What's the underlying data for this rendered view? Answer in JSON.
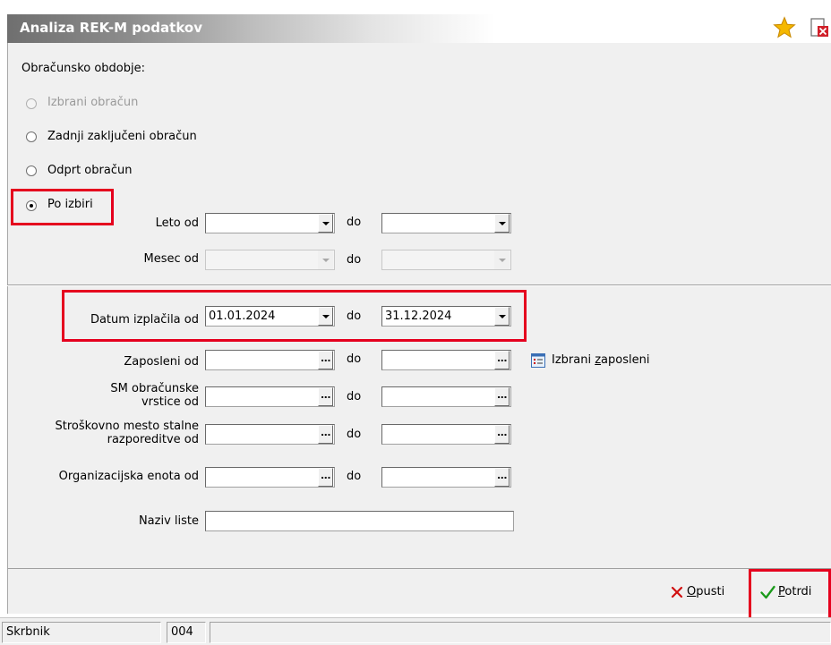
{
  "window": {
    "title": "Analiza REK-M podatkov",
    "icons": [
      "star-icon",
      "page-icon"
    ]
  },
  "period": {
    "label": "Obračunsko obdobje:",
    "options": [
      {
        "label": "Izbrani obračun",
        "state": "disabled"
      },
      {
        "label": "Zadnji zaključeni obračun",
        "state": "unchecked"
      },
      {
        "label": "Odprt obračun",
        "state": "unchecked"
      },
      {
        "label": "Po izbiri",
        "state": "checked"
      }
    ]
  },
  "fields": {
    "to": "do",
    "year_from": {
      "label": "Leto od",
      "value": "",
      "to_value": ""
    },
    "month_from": {
      "label": "Mesec od",
      "value": "",
      "to_value": ""
    },
    "pay_date_from": {
      "label": "Datum izplačila od",
      "value": "01.01.2024",
      "to_value": "31.12.2024"
    },
    "employee_from": {
      "label": "Zaposleni od",
      "value": "",
      "to_value": ""
    },
    "sm_lines_from": {
      "label_line1": "SM obračunske",
      "label_line2": "vrstice od",
      "value": "",
      "to_value": ""
    },
    "cost_center_from": {
      "label_line1": "Stroškovno mesto stalne",
      "label_line2": "razporeditve od",
      "value": "",
      "to_value": ""
    },
    "org_unit_from": {
      "label": "Organizacijska enota od",
      "value": "",
      "to_value": ""
    },
    "list_name": {
      "label": "Naziv liste",
      "value": ""
    },
    "selected_employees": {
      "pre": "Izbrani ",
      "accel": "z",
      "post": "aposleni"
    }
  },
  "footer": {
    "cancel": {
      "accel": "O",
      "rest": "pusti"
    },
    "confirm": {
      "accel": "P",
      "rest": "otrdi"
    }
  },
  "status": {
    "user": "Skrbnik",
    "code": "004",
    "info": ""
  },
  "colors": {
    "highlight": "#e5001e",
    "confirm_check": "#1a9a1a",
    "cancel_x": "#d01010"
  }
}
